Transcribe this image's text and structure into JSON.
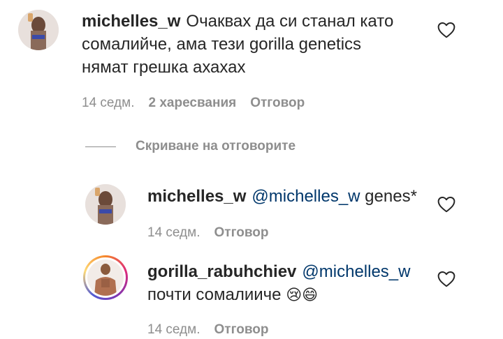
{
  "comments": [
    {
      "username": "michelles_w",
      "text_lines": [
        "Очаквах да си станал като",
        "сомалийче, ама тези gorilla genetics",
        "нямат грешка ахахах"
      ],
      "time": "14 седм.",
      "likes": "2 харесвания",
      "reply_label": "Отговор"
    }
  ],
  "hide_replies_label": "Скриване на отговорите",
  "replies": [
    {
      "username": "michelles_w",
      "mention": "@michelles_w",
      "text": "genes*",
      "time": "14 седм.",
      "reply_label": "Отговор"
    },
    {
      "username": "gorilla_rabuhchiev",
      "mention": "@michelles_w",
      "text": "почти сомалиичe",
      "emojis": "😢😄",
      "time": "14 седм.",
      "reply_label": "Отговор"
    }
  ],
  "icons": {
    "like": "heart-outline-icon"
  },
  "colors": {
    "mention": "#00376b",
    "meta": "#8e8e8e",
    "text": "#262626"
  }
}
